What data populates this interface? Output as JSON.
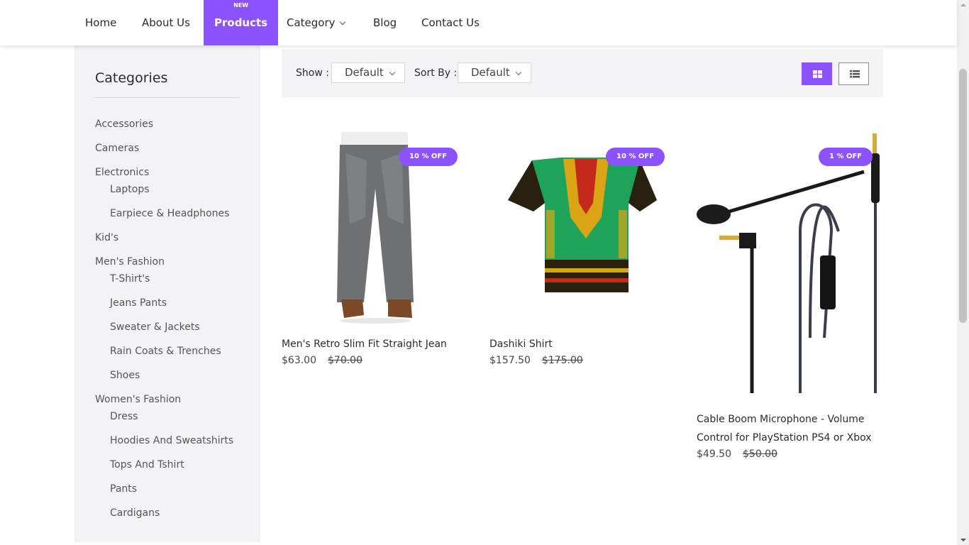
{
  "nav": {
    "items": [
      {
        "label": "Home"
      },
      {
        "label": "About Us"
      },
      {
        "label": "Products",
        "badge": "NEW",
        "active": true
      },
      {
        "label": "Category",
        "dropdown": true
      },
      {
        "label": "Blog"
      },
      {
        "label": "Contact Us"
      }
    ]
  },
  "sidebar": {
    "title": "Categories",
    "items": [
      {
        "label": "Accessories"
      },
      {
        "label": "Cameras"
      },
      {
        "label": "Electronics"
      },
      {
        "label": "Laptops",
        "sub": true
      },
      {
        "label": "Earpiece & Headphones",
        "sub": true
      },
      {
        "label": "Kid's"
      },
      {
        "label": "Men's Fashion"
      },
      {
        "label": "T-Shirt's",
        "sub": true
      },
      {
        "label": "Jeans Pants",
        "sub": true
      },
      {
        "label": "Sweater & Jackets",
        "sub": true
      },
      {
        "label": "Rain Coats & Trenches",
        "sub": true
      },
      {
        "label": "Shoes",
        "sub": true
      },
      {
        "label": "Women's Fashion"
      },
      {
        "label": "Dress",
        "sub": true
      },
      {
        "label": "Hoodies And Sweatshirts",
        "sub": true
      },
      {
        "label": "Tops And Tshirt",
        "sub": true
      },
      {
        "label": "Pants",
        "sub": true
      },
      {
        "label": "Cardigans",
        "sub": true
      }
    ]
  },
  "toolbar": {
    "show_label": "Show :",
    "show_value": "Default",
    "sort_label": "Sort By :",
    "sort_value": "Default",
    "active_view": "grid"
  },
  "products": [
    {
      "title": "Men's Retro Slim Fit Straight Jean",
      "price": "$63.00",
      "old_price": "$70.00",
      "badge": "10 % OFF"
    },
    {
      "title": "Dashiki Shirt",
      "price": "$157.50",
      "old_price": "$175.00",
      "badge": "10 % OFF"
    },
    {
      "title_lines": [
        "Cable Boom Microphone - Volume",
        "Control for PlayStation PS4 or Xbox"
      ],
      "price": "$49.50",
      "old_price": "$50.00",
      "badge": "1 % OFF"
    }
  ],
  "colors": {
    "accent": "#8c52ff",
    "panel": "#f3f3f6"
  }
}
